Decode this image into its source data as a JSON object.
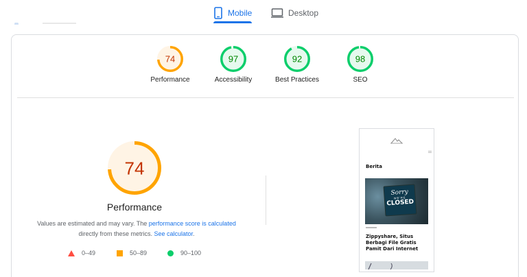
{
  "tabs": [
    {
      "label": "Mobile",
      "icon": "phone-icon",
      "active": true
    },
    {
      "label": "Desktop",
      "icon": "monitor-icon",
      "active": false
    }
  ],
  "summary_scores": [
    {
      "label": "Performance",
      "score": 74,
      "status": "average"
    },
    {
      "label": "Accessibility",
      "score": 97,
      "status": "pass"
    },
    {
      "label": "Best Practices",
      "score": 92,
      "status": "pass"
    },
    {
      "label": "SEO",
      "score": 98,
      "status": "pass"
    }
  ],
  "performance": {
    "score": 74,
    "title": "Performance",
    "note_prefix": "Values are estimated and may vary. The ",
    "note_link": "performance score is calculated",
    "note_middle": " directly from these metrics. ",
    "note_link2": "See calculator",
    "note_suffix": "."
  },
  "legend": [
    {
      "range": "0–49",
      "shape": "triangle",
      "color": "#ff4e42"
    },
    {
      "range": "50–89",
      "shape": "square",
      "color": "#ffa400"
    },
    {
      "range": "90–100",
      "shape": "circle",
      "color": "#0cce6b"
    }
  ],
  "preview": {
    "heading": "Berita",
    "sign_line1": "Sorry",
    "sign_line2": "WE'RE",
    "sign_line3": "CLOSED",
    "article_title": "Zippyshare, Situs Berbagi File Gratis Pamit Dari Internet"
  },
  "colors": {
    "accent": "#1a73e8",
    "average": "#ffa400",
    "average_text": "#c33300",
    "pass": "#0cce6b",
    "pass_text": "#008800"
  }
}
